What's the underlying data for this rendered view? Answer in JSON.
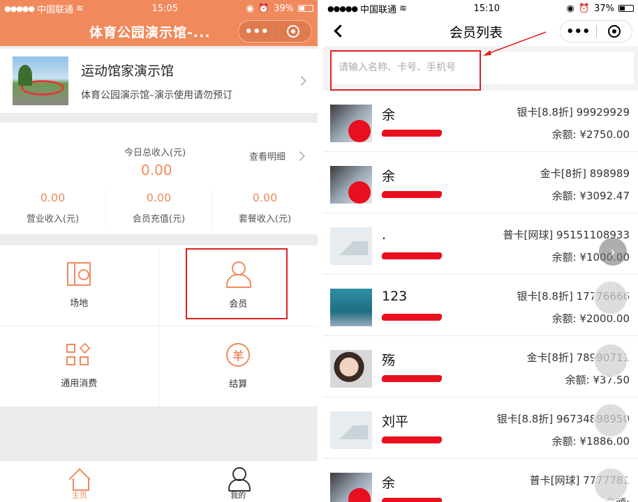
{
  "left": {
    "status": {
      "carrier": "中国联通",
      "time": "15:05",
      "battery": "39%"
    },
    "nav_title": "体育公园演示馆-...",
    "venue": {
      "name": "运动馆家演示馆",
      "desc": "体育公园演示馆–演示使用请勿预订"
    },
    "income": {
      "label": "今日总收入(元)",
      "total": "0.00",
      "detail": "查看明细",
      "items": [
        {
          "value": "0.00",
          "name": "营业收入(元)"
        },
        {
          "value": "0.00",
          "name": "会员充值(元)"
        },
        {
          "value": "0.00",
          "name": "套餐收入(元)"
        }
      ]
    },
    "grid": [
      {
        "label": "场地",
        "icon": "venue-icon"
      },
      {
        "label": "会员",
        "icon": "member-icon"
      },
      {
        "label": "通用消费",
        "icon": "consume-icon"
      },
      {
        "label": "结算",
        "icon": "settle-icon",
        "glyph": "羊"
      }
    ],
    "tabs": [
      {
        "label": "主页",
        "icon": "home-icon"
      },
      {
        "label": "我的",
        "icon": "profile-icon"
      }
    ]
  },
  "right": {
    "status": {
      "carrier": "中国联通",
      "time": "15:10",
      "battery": "37%"
    },
    "nav_title": "会员列表",
    "search_placeholder": "请输入名称、卡号、手机号",
    "members": [
      {
        "name": "余",
        "card": "银卡[8.8折] 99929929",
        "balance_label": "余额:",
        "balance": "¥2750.00",
        "avatar": "photo"
      },
      {
        "name": "余",
        "card": "金卡[8折] 898989",
        "balance_label": "余额:",
        "balance": "¥3092.47",
        "avatar": "photo"
      },
      {
        "name": ".",
        "card": "普卡[网球] 95151108933",
        "balance_label": "余额:",
        "balance": "¥1000.00",
        "avatar": "placeholder"
      },
      {
        "name": "123",
        "card": "银卡[8.8折] 17776666",
        "balance_label": "余额:",
        "balance": "¥2000.00",
        "avatar": "gym"
      },
      {
        "name": "殇",
        "card": "金卡[8折] 78990711",
        "balance_label": "余额:",
        "balance": "¥37.50",
        "avatar": "face"
      },
      {
        "name": "刘平",
        "card": "银卡[8.8折] 96734898950",
        "balance_label": "余额:",
        "balance": "¥1886.00",
        "avatar": "placeholder"
      },
      {
        "name": "余",
        "card": "普卡[网球] 7777781",
        "balance_label": "余额:",
        "balance": "",
        "avatar": "photo"
      }
    ]
  },
  "colors": {
    "primary": "#f08a5d",
    "highlight": "#e01f1f"
  }
}
